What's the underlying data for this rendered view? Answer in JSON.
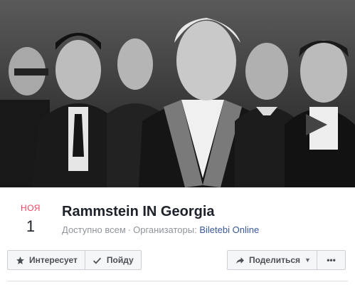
{
  "event": {
    "date_month": "НОЯ",
    "date_day": "1",
    "title": "Rammstein IN Georgia",
    "audience": "Доступно всем",
    "separator": "·",
    "organizers_label": "Организаторы:",
    "organizer_name": "Biletebi Online"
  },
  "actions": {
    "interested_label": "Интересует",
    "going_label": "Пойду",
    "share_label": "Поделиться",
    "more_label": "•••"
  },
  "colors": {
    "month": "#f3425f",
    "link": "#385898"
  },
  "icons": {
    "interested": "star-icon",
    "going": "checkmark-icon",
    "share": "share-arrow-icon",
    "dropdown": "caret-down-icon"
  }
}
